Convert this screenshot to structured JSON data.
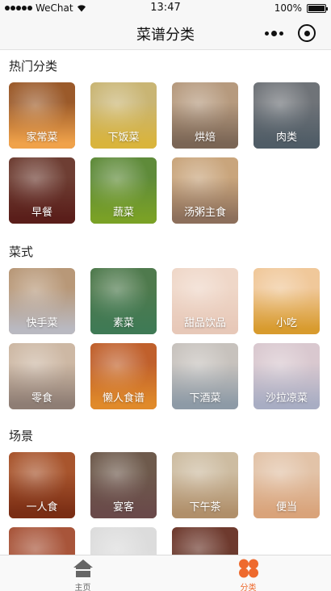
{
  "status_bar": {
    "carrier": "WeChat",
    "time": "13:47",
    "battery": "100%",
    "battery_level": 1.0
  },
  "nav": {
    "title": "菜谱分类"
  },
  "sections": [
    {
      "title": "热门分类",
      "items": [
        {
          "label": "家常菜",
          "color": "#f0a24a",
          "photo": "#9b5a2a"
        },
        {
          "label": "下饭菜",
          "color": "#d9b43c",
          "photo": "#c9b574"
        },
        {
          "label": "烘焙",
          "color": "#7a6555",
          "photo": "#b69a7e"
        },
        {
          "label": "肉类",
          "color": "#4f5c66",
          "photo": "#6f7378"
        },
        {
          "label": "早餐",
          "color": "#5a1e1a",
          "photo": "#6e3e33"
        },
        {
          "label": "蔬菜",
          "color": "#7aa126",
          "photo": "#5f8b3a"
        },
        {
          "label": "汤粥主食",
          "color": "#8c6f5b",
          "photo": "#c9a57c"
        }
      ]
    },
    {
      "title": "菜式",
      "items": [
        {
          "label": "快手菜",
          "color": "#b9b9c1",
          "photo": "#b89878"
        },
        {
          "label": "素菜",
          "color": "#3f7a55",
          "photo": "#4f7a4d"
        },
        {
          "label": "甜品饮品",
          "color": "#e7c8b8",
          "photo": "#efd7c8"
        },
        {
          "label": "小吃",
          "color": "#d89b2e",
          "photo": "#f0c89a"
        },
        {
          "label": "零食",
          "color": "#8e7d74",
          "photo": "#cdb8a4"
        },
        {
          "label": "懒人食谱",
          "color": "#e08a2a",
          "photo": "#c0602c"
        },
        {
          "label": "下酒菜",
          "color": "#8d9aa6",
          "photo": "#c7c2bd"
        },
        {
          "label": "沙拉凉菜",
          "color": "#a8adc3",
          "photo": "#d9c8cf"
        }
      ]
    },
    {
      "title": "场景",
      "items": [
        {
          "label": "一人食",
          "color": "#7a2d14",
          "photo": "#a8552d"
        },
        {
          "label": "宴客",
          "color": "#6a4a4a",
          "photo": "#6e5a4c"
        },
        {
          "label": "下午茶",
          "color": "#b08f6a",
          "photo": "#cdbca1"
        },
        {
          "label": "便当",
          "color": "#d9a37a",
          "photo": "#e2c3a8"
        },
        {
          "label": "",
          "color": "#b0553a",
          "photo": "#a8553a"
        },
        {
          "label": "",
          "color": "#e2e2e2",
          "photo": "#dcdcdc"
        },
        {
          "label": "",
          "color": "#5a3a2a",
          "photo": "#6e3a2e"
        }
      ]
    }
  ],
  "tab_bar": {
    "tabs": [
      {
        "label": "主页",
        "icon": "home-icon",
        "active": false,
        "color": "#666666"
      },
      {
        "label": "分类",
        "icon": "category-icon",
        "active": true,
        "color": "#ee6a2e"
      }
    ]
  }
}
